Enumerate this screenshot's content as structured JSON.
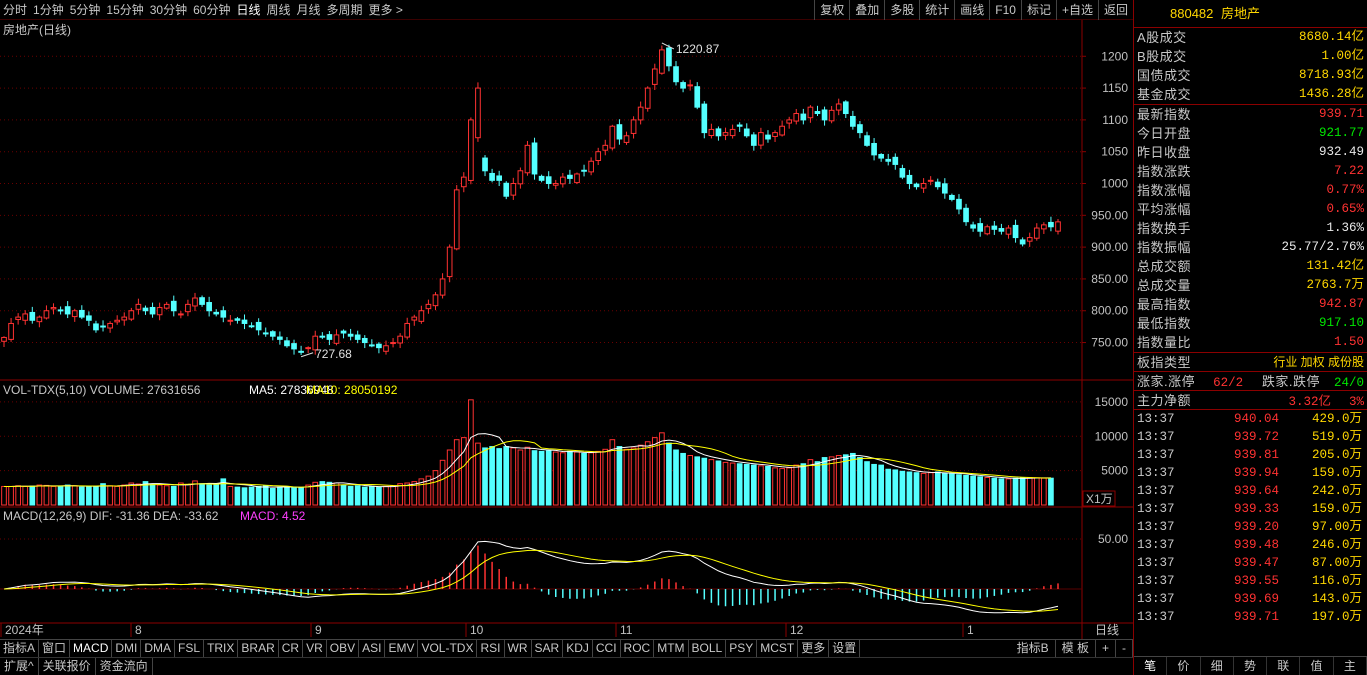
{
  "toolbar": {
    "periods": [
      "分时",
      "1分钟",
      "5分钟",
      "15分钟",
      "30分钟",
      "60分钟",
      "日线",
      "周线",
      "月线",
      "多周期",
      "更多 >"
    ],
    "active_period": "日线",
    "right_buttons": [
      "复权",
      "叠加",
      "多股",
      "统计",
      "画线",
      "F10",
      "标记",
      "+自选",
      "返回"
    ]
  },
  "chart": {
    "title": "房地产(日线)",
    "price_axis_labels": [
      "1200",
      "1150",
      "1100",
      "1050",
      "1000",
      "950.00",
      "900.00",
      "850.00",
      "800.00",
      "750.00"
    ],
    "high_label": "1220.87",
    "low_label": "727.68",
    "volume_header": {
      "name": "VOL-TDX(5,10)",
      "volume": "VOLUME: 27631656",
      "ma5": "MA5: 27836948",
      "ma10": "MA10: 28050192"
    },
    "volume_axis_labels": [
      "15000",
      "10000",
      "5000"
    ],
    "volume_unit": "X1万",
    "macd_header": {
      "name": "MACD(12,26,9)",
      "dif": "DIF: -31.36",
      "dea": "DEA: -33.62",
      "macd": "MACD: 4.52"
    },
    "macd_axis_label": "50.00",
    "date_labels": [
      "2024年",
      "8",
      "9",
      "10",
      "11",
      "12",
      "1"
    ],
    "period_label": "日线",
    "colors": {
      "up": "#ff3232",
      "down": "#54ffff",
      "ma5": "#ffffff",
      "ma10": "#ffff00",
      "grid": "#6a0000"
    }
  },
  "chart_data": {
    "type": "candlestick",
    "title": "房地产(日线)",
    "ylim": [
      710,
      1235
    ],
    "x_labels": [
      "2024年",
      "8",
      "9",
      "10",
      "11",
      "12",
      "1"
    ],
    "price_levels": [
      750,
      800,
      850,
      900,
      950,
      1000,
      1050,
      1100,
      1150,
      1200
    ],
    "annotations": [
      {
        "label": "1220.87",
        "value": 1220.87
      },
      {
        "label": "727.68",
        "value": 727.68
      }
    ],
    "series": [
      {
        "name": "房地产",
        "close": [
          758,
          780,
          790,
          795,
          785,
          790,
          800,
          805,
          800,
          795,
          800,
          790,
          785,
          770,
          775,
          780,
          785,
          790,
          800,
          810,
          800,
          795,
          805,
          810,
          800,
          795,
          810,
          820,
          810,
          800,
          795,
          790,
          785,
          785,
          780,
          775,
          770,
          765,
          760,
          755,
          745,
          740,
          735,
          742,
          760,
          760,
          755,
          762,
          765,
          760,
          755,
          750,
          745,
          742,
          745,
          750,
          760,
          780,
          790,
          800,
          810,
          825,
          850,
          900,
          990,
          1010,
          1100,
          1150,
          1020,
          1005,
          1005,
          980,
          1000,
          1020,
          1060,
          1015,
          1005,
          1000,
          1000,
          1010,
          1008,
          1015,
          1020,
          1035,
          1050,
          1060,
          1090,
          1070,
          1075,
          1100,
          1120,
          1150,
          1180,
          1210,
          1185,
          1160,
          1150,
          1155,
          1120,
          1080,
          1085,
          1075,
          1080,
          1085,
          1090,
          1075,
          1060,
          1080,
          1070,
          1080,
          1090,
          1100,
          1110,
          1100,
          1120,
          1110,
          1100,
          1115,
          1125,
          1110,
          1090,
          1080,
          1060,
          1045,
          1040,
          1035,
          1030,
          1010,
          1000,
          995,
          1000,
          1005,
          995,
          985,
          975,
          960,
          940,
          930,
          925,
          932,
          928,
          925,
          930,
          915,
          905,
          915,
          930,
          935,
          932,
          939.71
        ],
        "volume_wan": [
          2700,
          2700,
          2800,
          2700,
          2750,
          2900,
          2850,
          2700,
          2750,
          2900,
          2800,
          2600,
          2650,
          2700,
          3100,
          2800,
          2700,
          2900,
          3200,
          3050,
          3400,
          3000,
          2900,
          2800,
          2700,
          3200,
          3000,
          3500,
          3100,
          2900,
          3100,
          3800,
          2700,
          2600,
          2500,
          2600,
          2700,
          2800,
          2400,
          2600,
          2700,
          2600,
          2500,
          2900,
          3300,
          3400,
          3300,
          3200,
          2900,
          2700,
          2800,
          2600,
          2700,
          2600,
          2700,
          2800,
          3100,
          3200,
          3400,
          3800,
          4200,
          5000,
          6500,
          8000,
          9500,
          9800,
          15300,
          9000,
          8300,
          8500,
          8200,
          8500,
          8300,
          8000,
          8400,
          7900,
          7800,
          7900,
          7700,
          7600,
          7800,
          7700,
          7500,
          7600,
          7800,
          8100,
          9500,
          8500,
          8100,
          8300,
          8700,
          9200,
          9800,
          10500,
          9000,
          8000,
          7500,
          7200,
          7000,
          6800,
          6600,
          6400,
          6200,
          6100,
          6000,
          5900,
          5800,
          5700,
          5600,
          5400,
          5300,
          5400,
          5800,
          6000,
          6600,
          6300,
          6900,
          7000,
          7200,
          7300,
          7500,
          6900,
          6300,
          5900,
          5800,
          5200,
          5100,
          4900,
          4800,
          4700,
          4600,
          4700,
          4800,
          4600,
          4500,
          4400,
          4300,
          4200,
          4100,
          4000,
          3900,
          3800,
          3800,
          3900,
          3950,
          4000,
          3950,
          3900,
          3900
        ]
      }
    ]
  },
  "panel": {
    "code": "880482",
    "name": "房地产",
    "stats": [
      {
        "k": "A股成交",
        "v": "8680.14亿",
        "c": "yellow"
      },
      {
        "k": "B股成交",
        "v": "1.00亿",
        "c": "yellow"
      },
      {
        "k": "国债成交",
        "v": "8718.93亿",
        "c": "yellow"
      },
      {
        "k": "基金成交",
        "v": "1436.28亿",
        "c": "yellow"
      }
    ],
    "quote": [
      {
        "k": "最新指数",
        "v": "939.71",
        "c": "red"
      },
      {
        "k": "今日开盘",
        "v": "921.77",
        "c": "green"
      },
      {
        "k": "昨日收盘",
        "v": "932.49",
        "c": "white"
      },
      {
        "k": "指数涨跌",
        "v": "7.22",
        "c": "red"
      },
      {
        "k": "指数涨幅",
        "v": "0.77%",
        "c": "red"
      },
      {
        "k": "平均涨幅",
        "v": "0.65%",
        "c": "red"
      },
      {
        "k": "指数换手",
        "v": "1.36%",
        "c": "white"
      },
      {
        "k": "指数振幅",
        "v": "25.77/2.76%",
        "c": "white"
      },
      {
        "k": "总成交额",
        "v": "131.42亿",
        "c": "yellow"
      },
      {
        "k": "总成交量",
        "v": "2763.7万",
        "c": "yellow"
      },
      {
        "k": "最高指数",
        "v": "942.87",
        "c": "red"
      },
      {
        "k": "最低指数",
        "v": "917.10",
        "c": "green"
      },
      {
        "k": "指数量比",
        "v": "1.50",
        "c": "red"
      }
    ],
    "type_label": "板指类型",
    "type_value": "行业 加权 成份股",
    "breadth": {
      "up_label": "涨家.涨停",
      "up_value": "62/2",
      "down_label": "跌家.跌停",
      "down_value": "24/0"
    },
    "flow": {
      "label": "主力净额",
      "value": "3.32亿",
      "pct": "3%"
    },
    "ticks": [
      {
        "t": "13:37",
        "p": "940.04",
        "q": "429.0万"
      },
      {
        "t": "13:37",
        "p": "939.72",
        "q": "519.0万"
      },
      {
        "t": "13:37",
        "p": "939.81",
        "q": "205.0万"
      },
      {
        "t": "13:37",
        "p": "939.94",
        "q": "159.0万"
      },
      {
        "t": "13:37",
        "p": "939.64",
        "q": "242.0万"
      },
      {
        "t": "13:37",
        "p": "939.33",
        "q": "159.0万"
      },
      {
        "t": "13:37",
        "p": "939.20",
        "q": "97.00万"
      },
      {
        "t": "13:37",
        "p": "939.48",
        "q": "246.0万"
      },
      {
        "t": "13:37",
        "p": "939.47",
        "q": "87.00万"
      },
      {
        "t": "13:37",
        "p": "939.55",
        "q": "116.0万"
      },
      {
        "t": "13:37",
        "p": "939.69",
        "q": "143.0万"
      },
      {
        "t": "13:37",
        "p": "939.71",
        "q": "197.0万"
      }
    ],
    "tabs": [
      "笔",
      "价",
      "细",
      "势",
      "联",
      "值",
      "主"
    ]
  },
  "indicators": {
    "tabs": [
      "指标A",
      "窗口",
      "MACD",
      "DMI",
      "DMA",
      "FSL",
      "TRIX",
      "BRAR",
      "CR",
      "VR",
      "OBV",
      "ASI",
      "EMV",
      "VOL-TDX",
      "RSI",
      "WR",
      "SAR",
      "KDJ",
      "CCI",
      "ROC",
      "MTM",
      "BOLL",
      "PSY",
      "MCST",
      "更多",
      "设置"
    ],
    "active": "MACD",
    "right": [
      "指标B",
      "模 板",
      "+",
      "-"
    ]
  },
  "bottom": [
    "扩展^",
    "关联报价",
    "资金流向"
  ]
}
